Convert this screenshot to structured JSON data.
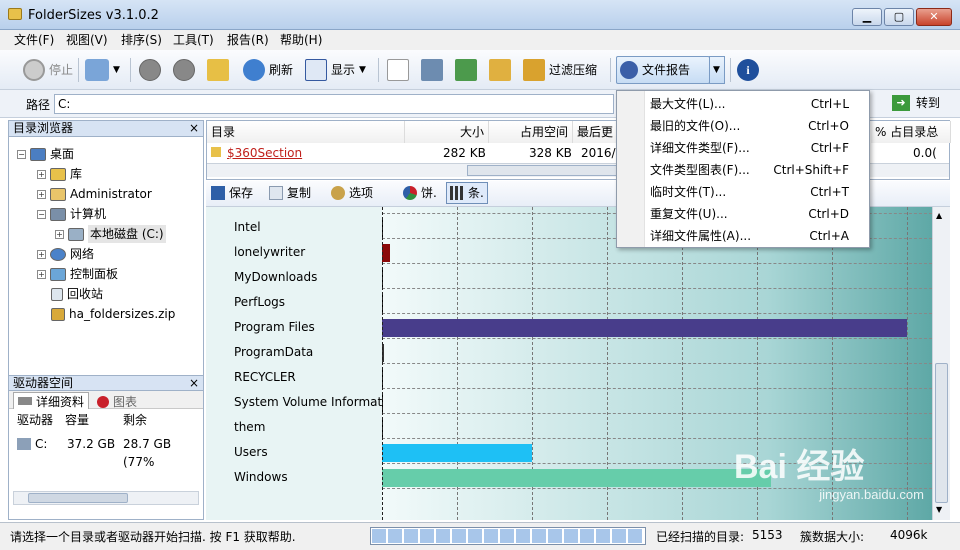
{
  "window": {
    "title": "FolderSizes v3.1.0.2",
    "min": "0",
    "max": "1",
    "close": "r"
  },
  "menu": [
    "文件(F)",
    "视图(V)",
    "排序(S)",
    "工具(T)",
    "报告(R)",
    "帮助(H)"
  ],
  "toolbar": {
    "stop": "停止",
    "refresh": "刷新",
    "display": "显示",
    "filter_compress": "过滤压缩",
    "file_report": "文件报告",
    "goto": "转到"
  },
  "path": {
    "label": "路径",
    "value": "C:"
  },
  "dir_browser": {
    "title": "目录浏览器",
    "close": "×",
    "items": [
      "桌面",
      "库",
      "Administrator",
      "计算机",
      "本地磁盘 (C:)",
      "网络",
      "控制面板",
      "回收站",
      "ha_foldersizes.zip"
    ]
  },
  "drive_space": {
    "title": "驱动器空间",
    "close": "×",
    "tabs": [
      "详细资料",
      "图表"
    ],
    "headers": [
      "驱动器",
      "容量",
      "剩余"
    ],
    "rows": [
      {
        "drive": "C:",
        "capacity": "37.2 GB",
        "free": "28.7 GB (77%"
      }
    ]
  },
  "list": {
    "headers": [
      "目录",
      "大小",
      "占用空间",
      "最后更",
      "% 占目录总"
    ],
    "row": {
      "name": "$360Section",
      "size": "282 KB",
      "alloc": "328 KB",
      "date": "2016/",
      "percent": "0.0("
    }
  },
  "chart_toolbar": {
    "save": "保存",
    "copy": "复制",
    "options": "选项",
    "pie": "饼.",
    "bar": "条."
  },
  "chart_data": {
    "type": "bar",
    "orientation": "horizontal",
    "categories": [
      "Intel",
      "lonelywriter",
      "MyDownloads",
      "PerfLogs",
      "Program Files",
      "ProgramData",
      "RECYCLER",
      "System Volume Informatio",
      "them",
      "Users",
      "Windows"
    ],
    "values": [
      0,
      1.5,
      0,
      0,
      100,
      0.3,
      0,
      0,
      0,
      28.5,
      74
    ],
    "colors": [
      "#000000",
      "#8b0a0a",
      "#000000",
      "#000000",
      "#483d8b",
      "#333333",
      "#000000",
      "#000000",
      "#000000",
      "#1ec0f5",
      "#66cdaa"
    ],
    "xlim": [
      0,
      100
    ],
    "grid": true,
    "legend": "none"
  },
  "dropdown": [
    {
      "label": "最大文件(L)...",
      "shortcut": "Ctrl+L"
    },
    {
      "label": "最旧的文件(O)...",
      "shortcut": "Ctrl+O"
    },
    {
      "label": "详细文件类型(F)...",
      "shortcut": "Ctrl+F"
    },
    {
      "label": "文件类型图表(F)...",
      "shortcut": "Ctrl+Shift+F"
    },
    {
      "label": "临时文件(T)...",
      "shortcut": "Ctrl+T"
    },
    {
      "label": "重复文件(U)...",
      "shortcut": "Ctrl+D"
    },
    {
      "label": "详细文件属性(A)...",
      "shortcut": "Ctrl+A"
    }
  ],
  "status": {
    "message": "请选择一个目录或者驱动器开始扫描. 按 F1 获取帮助.",
    "scanned_label": "已经扫描的目录:",
    "scanned_value": "5153",
    "cluster_label": "簇数据大小:",
    "cluster_value": "4096k"
  },
  "watermark": {
    "brand": "Bai 经验",
    "url": "jingyan.baidu.com"
  },
  "colors": {
    "accent": "#3b6fb6",
    "dropdown_highlight": "#cce3fb"
  }
}
